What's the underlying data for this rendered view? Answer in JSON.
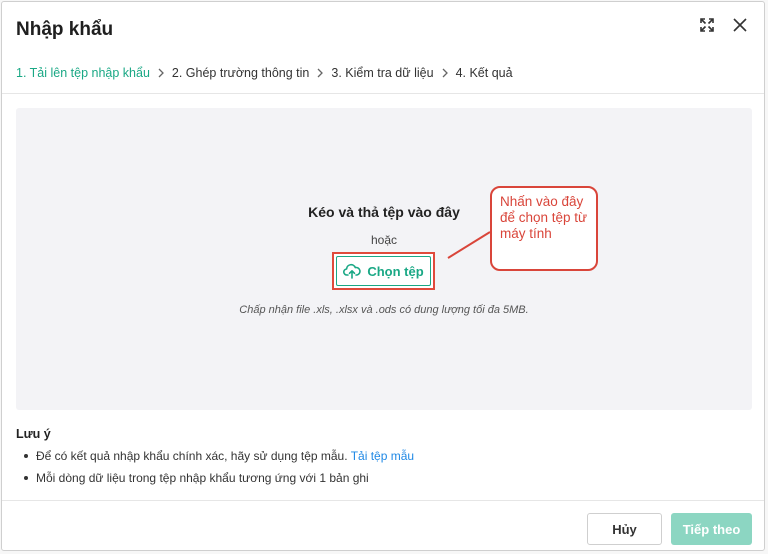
{
  "dialog": {
    "title": "Nhập khẩu",
    "expand_icon": "expand-icon",
    "close_icon": "close-icon"
  },
  "steps": [
    {
      "label": "1. Tải lên tệp nhập khẩu",
      "active": true
    },
    {
      "label": "2. Ghép trường thông tin",
      "active": false
    },
    {
      "label": "3. Kiểm tra dữ liệu",
      "active": false
    },
    {
      "label": "4. Kết quả",
      "active": false
    }
  ],
  "dropzone": {
    "title": "Kéo và thả tệp vào đây",
    "or": "hoặc",
    "choose_label": "Chọn tệp",
    "choose_icon": "cloud-upload-icon",
    "note": "Chấp nhận file .xls, .xlsx và .ods có dung lượng tối đa 5MB."
  },
  "callout": {
    "text": "Nhấn vào đây để chọn tệp từ máy tính"
  },
  "notes": {
    "title": "Lưu ý",
    "item1_text": "Để có kết quả nhập khẩu chính xác, hãy sử dụng tệp mẫu.",
    "item1_link": "Tải tệp mẫu",
    "item2_text": "Mỗi dòng dữ liệu trong tệp nhập khẩu tương ứng với 1 bản ghi"
  },
  "footer": {
    "cancel_label": "Hủy",
    "next_label": "Tiếp theo"
  },
  "colors": {
    "accent": "#1aa885",
    "accent_disabled": "#8cd6c2",
    "annotation": "#d9453a",
    "link": "#1e88e5"
  }
}
